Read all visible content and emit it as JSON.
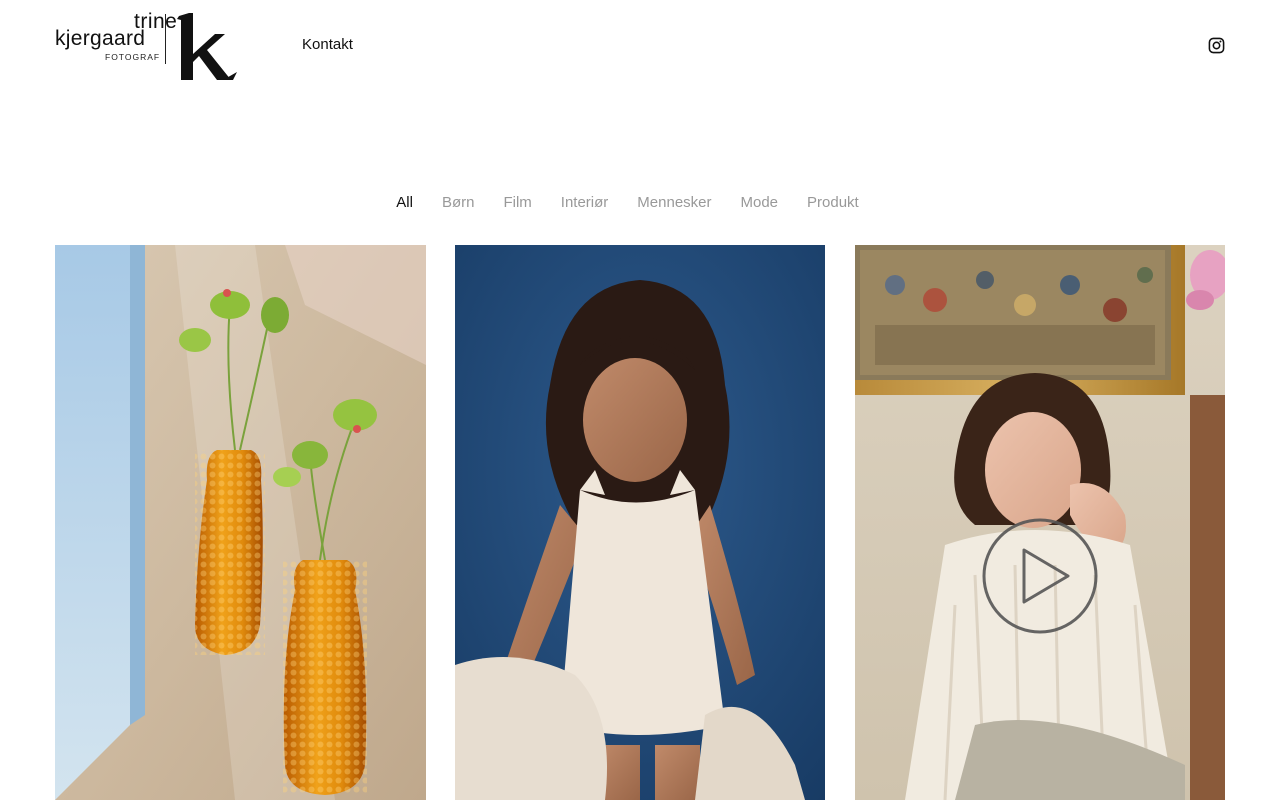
{
  "logo": {
    "line1": "trine",
    "line2": "kjergaard",
    "line3": "FOTOGRAF",
    "mark": "k"
  },
  "nav": {
    "contact_label": "Kontakt"
  },
  "social": {
    "instagram_icon": "instagram-icon"
  },
  "filters": [
    {
      "label": "All",
      "active": true
    },
    {
      "label": "Børn",
      "active": false
    },
    {
      "label": "Film",
      "active": false
    },
    {
      "label": "Interiør",
      "active": false
    },
    {
      "label": "Mennesker",
      "active": false
    },
    {
      "label": "Mode",
      "active": false
    },
    {
      "label": "Produkt",
      "active": false
    }
  ],
  "gallery": [
    {
      "subject": "amber glass vases with flowers",
      "has_play": false
    },
    {
      "subject": "child in white top with blanket",
      "has_play": false
    },
    {
      "subject": "woman in cream blouse before painting",
      "has_play": true
    }
  ],
  "colors": {
    "text": "#111111",
    "filter_inactive": "#999999",
    "background": "#ffffff"
  }
}
